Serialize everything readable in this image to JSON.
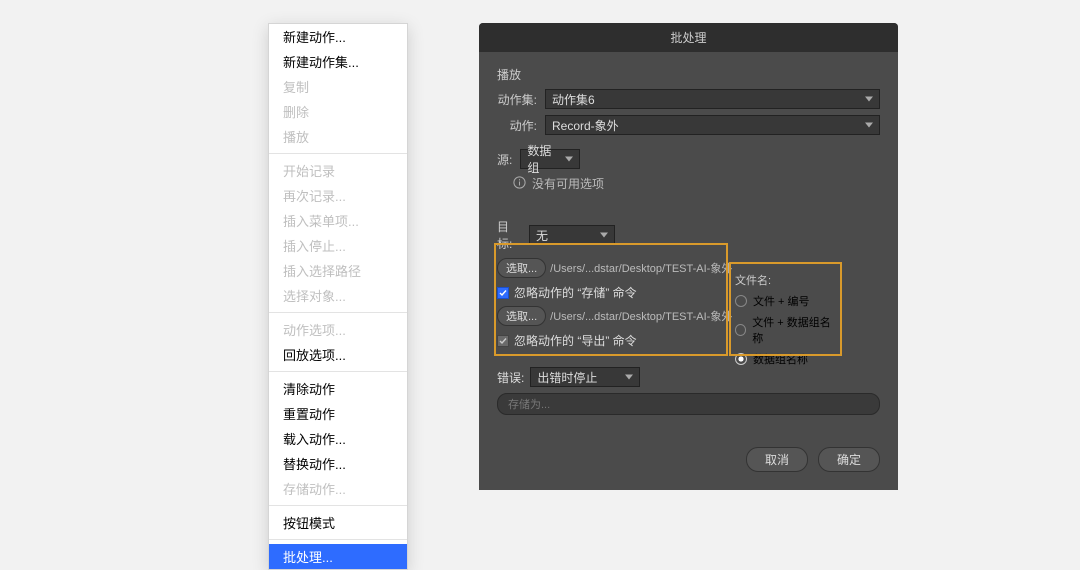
{
  "menu": {
    "items": [
      {
        "label": "新建动作...",
        "state": "enabled"
      },
      {
        "label": "新建动作集...",
        "state": "enabled"
      },
      {
        "label": "复制",
        "state": "disabled"
      },
      {
        "label": "删除",
        "state": "disabled"
      },
      {
        "label": "播放",
        "state": "disabled"
      },
      {
        "sep": true
      },
      {
        "label": "开始记录",
        "state": "disabled"
      },
      {
        "label": "再次记录...",
        "state": "disabled"
      },
      {
        "label": "插入菜单项...",
        "state": "disabled"
      },
      {
        "label": "插入停止...",
        "state": "disabled"
      },
      {
        "label": "插入选择路径",
        "state": "disabled"
      },
      {
        "label": "选择对象...",
        "state": "disabled"
      },
      {
        "sep": true
      },
      {
        "label": "动作选项...",
        "state": "disabled"
      },
      {
        "label": "回放选项...",
        "state": "enabled"
      },
      {
        "sep": true
      },
      {
        "label": "清除动作",
        "state": "enabled"
      },
      {
        "label": "重置动作",
        "state": "enabled"
      },
      {
        "label": "载入动作...",
        "state": "enabled"
      },
      {
        "label": "替换动作...",
        "state": "enabled"
      },
      {
        "label": "存储动作...",
        "state": "disabled"
      },
      {
        "sep": true
      },
      {
        "label": "按钮模式",
        "state": "enabled"
      },
      {
        "sep": true
      },
      {
        "label": "批处理...",
        "state": "selected"
      }
    ]
  },
  "dialog": {
    "title": "批处理",
    "play": {
      "section": "播放",
      "setLabel": "动作集:",
      "setValue": "动作集6",
      "actionLabel": "动作:",
      "actionValue": "Record-象外"
    },
    "source": {
      "label": "源:",
      "value": "数据组",
      "info": "没有可用选项"
    },
    "target": {
      "label": "目标:",
      "value": "无",
      "chooseBtn": "选取...",
      "path": "/Users/...dstar/Desktop/TEST-AI-象外",
      "overrideSave": "忽略动作的 “存储” 命令",
      "overrideExport": "忽略动作的 “导出” 命令"
    },
    "filename": {
      "label": "文件名:",
      "opt1": "文件 + 编号",
      "opt2": "文件 + 数据组名称",
      "opt3": "数据组名称"
    },
    "error": {
      "label": "错误:",
      "value": "出错时停止",
      "saveAs": "存储为..."
    },
    "buttons": {
      "cancel": "取消",
      "ok": "确定"
    }
  }
}
